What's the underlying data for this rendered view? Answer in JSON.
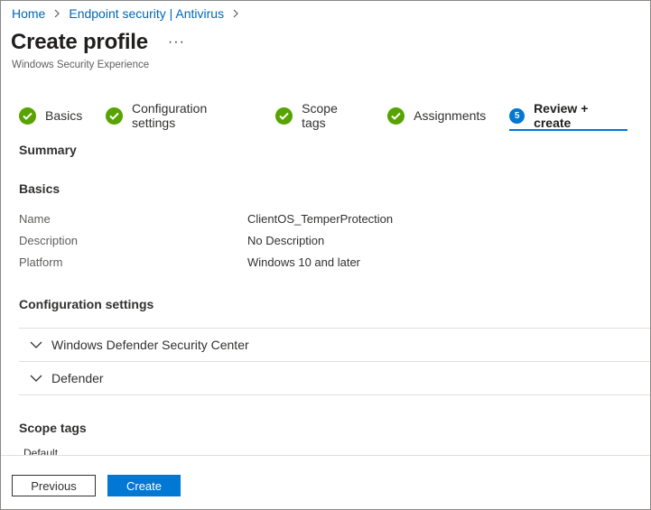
{
  "breadcrumb": [
    {
      "label": "Home"
    },
    {
      "label": "Endpoint security | Antivirus"
    }
  ],
  "header": {
    "title": "Create profile",
    "more_label": "···",
    "subtitle": "Windows Security Experience"
  },
  "steps": [
    {
      "label": "Basics",
      "status": "complete"
    },
    {
      "label": "Configuration settings",
      "status": "complete"
    },
    {
      "label": "Scope tags",
      "status": "complete"
    },
    {
      "label": "Assignments",
      "status": "complete"
    },
    {
      "label": "Review + create",
      "status": "current",
      "number": "5"
    }
  ],
  "summary": {
    "heading": "Summary",
    "basics_heading": "Basics",
    "fields": [
      {
        "label": "Name",
        "value": "ClientOS_TemperProtection"
      },
      {
        "label": "Description",
        "value": "No Description"
      },
      {
        "label": "Platform",
        "value": "Windows 10 and later"
      }
    ],
    "config_heading": "Configuration settings",
    "config_groups": [
      {
        "label": "Windows Defender Security Center"
      },
      {
        "label": "Defender"
      }
    ],
    "scope_heading": "Scope tags",
    "scope_value": "Default"
  },
  "footer": {
    "previous_label": "Previous",
    "create_label": "Create"
  },
  "colors": {
    "link": "#0067b8",
    "accent": "#0078d4",
    "complete": "#57a300"
  },
  "icons": {
    "breadcrumb_separator": "chevron-right-icon",
    "step_complete": "checkmark-circle-icon",
    "accordion": "chevron-down-icon"
  }
}
